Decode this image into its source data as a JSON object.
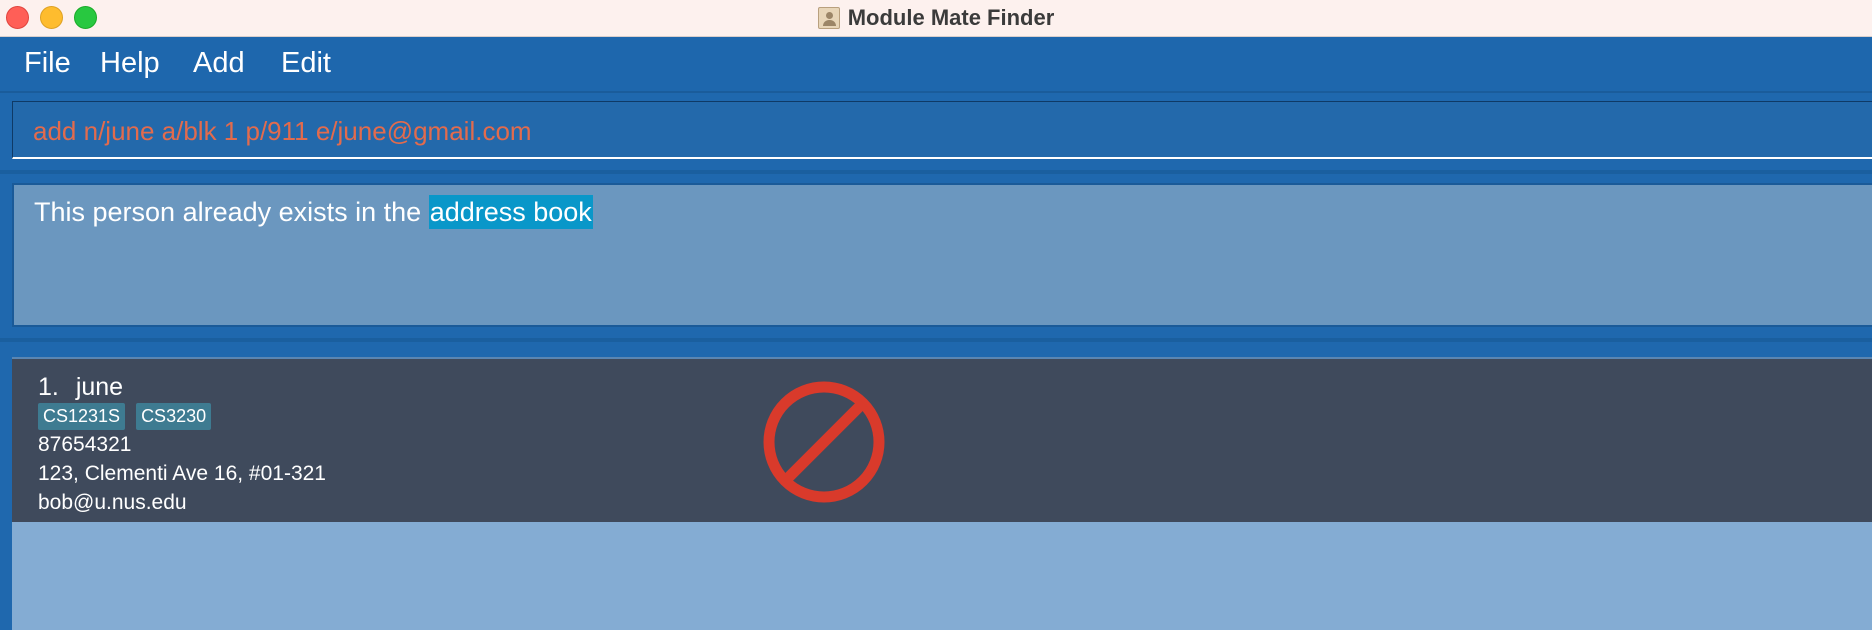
{
  "window": {
    "title": "Module Mate Finder"
  },
  "menu": {
    "items": [
      "File",
      "Help",
      "Add",
      "Edit"
    ]
  },
  "command_box": {
    "value": "add n/june a/blk 1 p/911 e/june@gmail.com"
  },
  "result_display": {
    "text_before": "This person already exists in the ",
    "text_highlighted": "address book"
  },
  "person_list": {
    "persons": [
      {
        "index": "1.",
        "name": "june",
        "tags": [
          "CS1231S",
          "CS3230"
        ],
        "phone": "87654321",
        "address": "123, Clementi Ave 16, #01-321",
        "email": "bob@u.nus.edu"
      }
    ]
  },
  "colors": {
    "command_text": "#e26b4d",
    "highlight": "#0997c9",
    "card_background": "#3f4a5c",
    "tag_background": "#3e7b91",
    "no_symbol": "#d93a2b"
  },
  "overlay_icon": "no-entry-icon"
}
